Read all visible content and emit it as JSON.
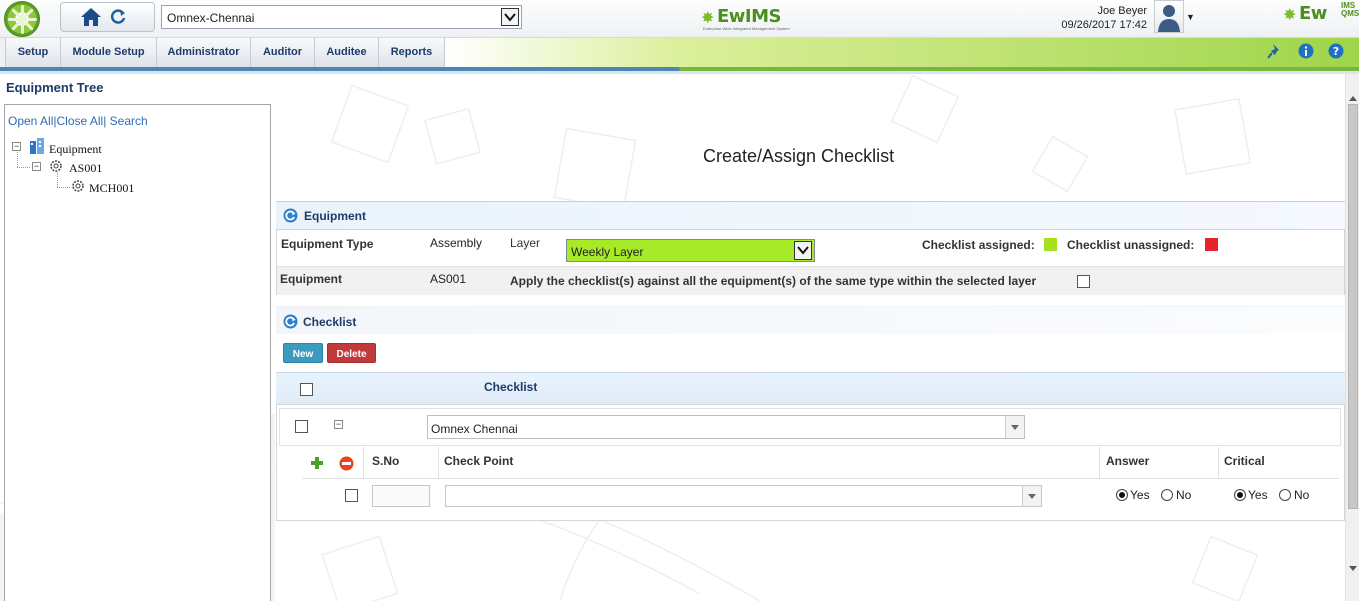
{
  "header": {
    "location": "Omnex-Chennai",
    "brand_center": "EwIMS",
    "brand_center_tagline": "Enterprise-Wide Integrated Management System",
    "user_name": "Joe Beyer",
    "date_time": "09/26/2017 17:42",
    "brand_right": "Ew",
    "brand_right_sup_top": "IMS",
    "brand_right_sup_bottom": "QMS"
  },
  "menu": {
    "items": [
      {
        "label": "Setup"
      },
      {
        "label": "Module Setup"
      },
      {
        "label": "Administrator"
      },
      {
        "label": "Auditor"
      },
      {
        "label": "Auditee"
      },
      {
        "label": "Reports"
      }
    ],
    "icons": [
      "pin-icon",
      "info-icon",
      "help-icon"
    ]
  },
  "tree": {
    "title": "Equipment Tree",
    "link_open_all": "Open All",
    "sep1": "|",
    "link_close_all": "Close All",
    "sep2": "|",
    "link_search": "Search",
    "nodes": [
      {
        "label": "Equipment"
      },
      {
        "label": "AS001"
      },
      {
        "label": "MCH001"
      }
    ]
  },
  "page": {
    "title": "Create/Assign Checklist"
  },
  "equipment_section": {
    "title": "Equipment",
    "type_label": "Equipment Type",
    "type_value": "Assembly",
    "layer_label": "Layer",
    "layer_value": "Weekly Layer",
    "assigned_label": "Checklist assigned:",
    "assigned_color": "#a6e01e",
    "unassigned_label": "Checklist unassigned:",
    "unassigned_color": "#e8222a",
    "equipment_label": "Equipment",
    "equipment_value": "AS001",
    "apply_label": "Apply the checklist(s) against all the equipment(s) of the same type within the selected layer",
    "apply_checked": false
  },
  "checklist_section": {
    "title": "Checklist",
    "new_label": "New",
    "delete_label": "Delete",
    "column_header": "Checklist",
    "group_value": "Omnex Chennai",
    "columns": {
      "sno": "S.No",
      "check_point": "Check Point",
      "answer": "Answer",
      "critical": "Critical"
    },
    "row": {
      "sno": "",
      "check_point": "",
      "answer": "Yes",
      "critical": "Yes"
    },
    "yes_label": "Yes",
    "no_label": "No"
  }
}
